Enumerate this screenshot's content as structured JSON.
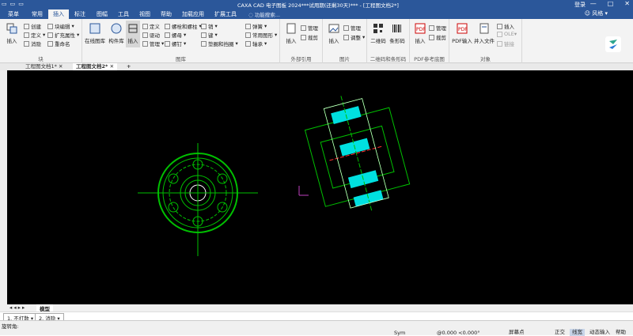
{
  "titlebar": {
    "title": "CAXA CAD 电子图板 2024***试用期(还剩30天)*** - [工程图文档2*]",
    "login": "登录",
    "min": "—",
    "max": "□",
    "close": "✕"
  },
  "tabs": [
    "菜单",
    "常用",
    "插入",
    "标注",
    "图幅",
    "工具",
    "视图",
    "帮助",
    "加载应用",
    "扩展工具"
  ],
  "search_placeholder": "功能搜索...",
  "style_label": "风格",
  "ribbon": {
    "block": {
      "insert": "插入",
      "create": "创建",
      "define": "定义",
      "dissolve": "消隐",
      "block_edit": "块编辑",
      "extend_attr": "扩充属性",
      "rename": "重命名",
      "group": "块"
    },
    "library": {
      "online": "在线图库",
      "component": "构件库",
      "insert": "插入",
      "define": "定义",
      "drive": "驱动",
      "manage": "管理",
      "bolt": "螺栓和螺柱",
      "screw": "螺母",
      "nail": "螺钉",
      "pin": "销",
      "key": "键",
      "gear": "垫圈和挡圈",
      "spring": "弹簧",
      "common": "常用图形",
      "bearing": "轴承",
      "group": "图库"
    },
    "extref": {
      "insert": "插入",
      "manage": "管理",
      "crop": "裁剪",
      "group": "外部引用"
    },
    "image": {
      "insert": "插入",
      "manage": "管理",
      "adjust": "调整",
      "group": "图片"
    },
    "barcode": {
      "qr": "二维码",
      "bar": "条形码",
      "group": "二维码和条形码"
    },
    "pdf": {
      "insert": "插入",
      "manage": "管理",
      "crop": "裁剪",
      "group": "PDF参考底图"
    },
    "object": {
      "pdf_in": "PDF输入",
      "file_in": "并入文件",
      "insert": "插入",
      "ole": "OLE▾",
      "link": "链接",
      "group": "对象"
    }
  },
  "doc_tabs": [
    "工程图文档1*",
    "工程图文档2*"
  ],
  "model_tab": "模型",
  "cmd": {
    "opt1": "1.  不打散",
    "opt2": "2.  消隐",
    "prompt": "旋转角:"
  },
  "status": {
    "sym": "Sym",
    "coord": "@0.000 <0.000°",
    "screen_point": "屏幕点",
    "ortho": "正交",
    "lineweight": "线宽",
    "dynamic": "动态输入",
    "help": "帮助"
  },
  "colors": {
    "ribbon_blue": "#2b579a",
    "canvas": "#000000",
    "drawing_green": "#00c000",
    "cyan": "#00e0e0",
    "red_axis": "#ff3030"
  }
}
